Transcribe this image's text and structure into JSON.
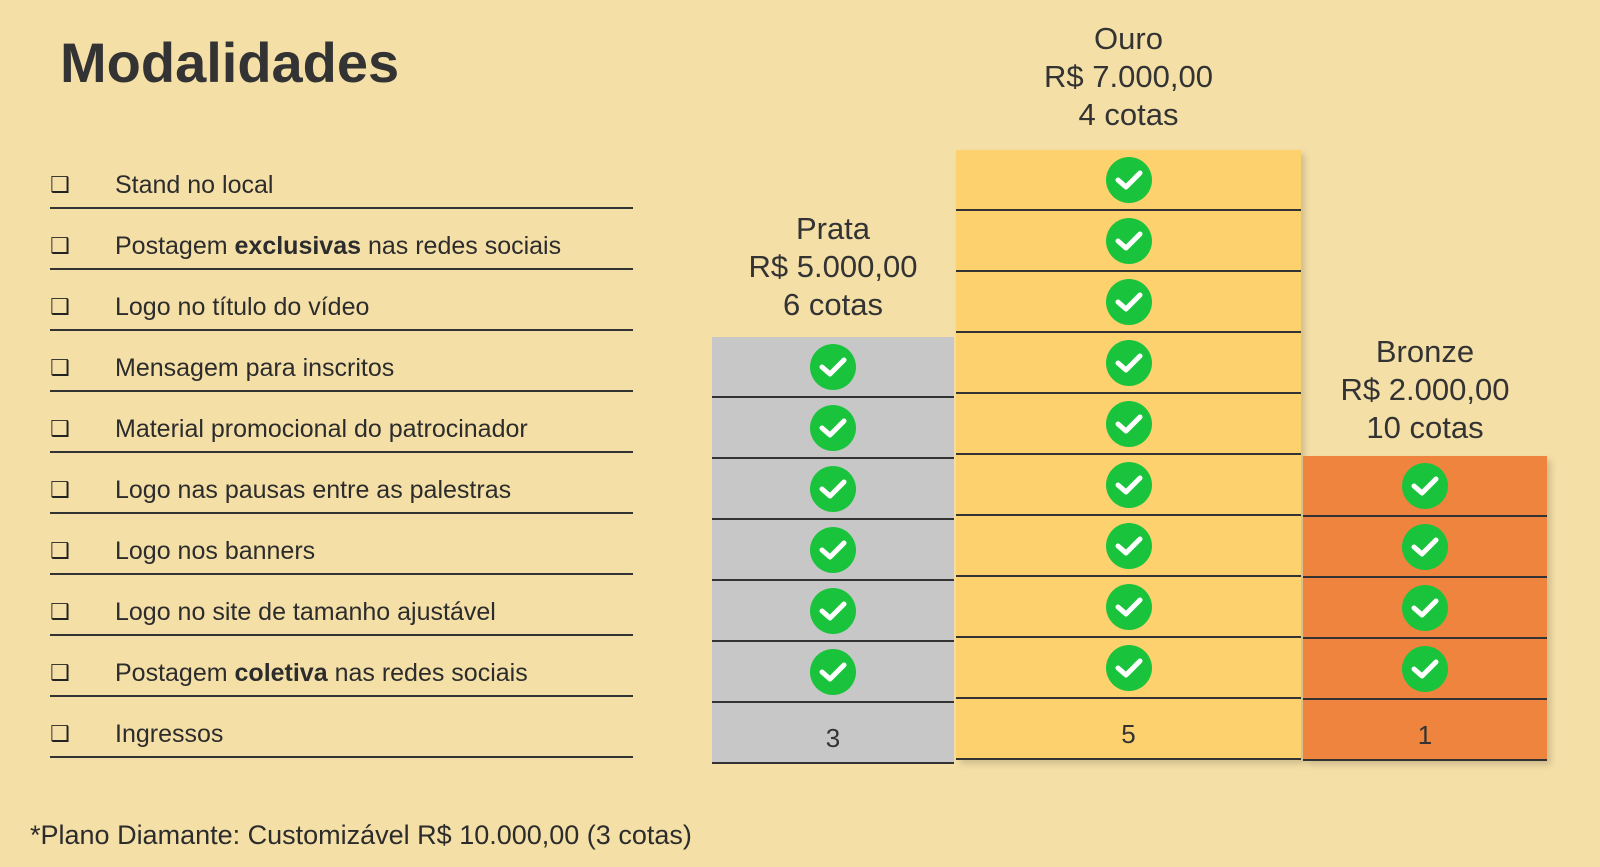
{
  "title": "Modalidades",
  "features": [
    {
      "pre": "Stand no local",
      "bold": "",
      "post": ""
    },
    {
      "pre": "Postagem ",
      "bold": "exclusivas",
      "post": " nas redes sociais"
    },
    {
      "pre": "Logo no título do vídeo",
      "bold": "",
      "post": ""
    },
    {
      "pre": "Mensagem para inscritos",
      "bold": "",
      "post": ""
    },
    {
      "pre": "Material promocional do patrocinador",
      "bold": "",
      "post": ""
    },
    {
      "pre": "Logo nas pausas entre as palestras",
      "bold": "",
      "post": ""
    },
    {
      "pre": "Logo nos banners",
      "bold": "",
      "post": ""
    },
    {
      "pre": "Logo no site de tamanho ajustável",
      "bold": "",
      "post": ""
    },
    {
      "pre": "Postagem ",
      "bold": "coletiva",
      "post": " nas redes sociais"
    },
    {
      "pre": "Ingressos",
      "bold": "",
      "post": ""
    }
  ],
  "bullet_glyph": "❑",
  "plans": {
    "prata": {
      "name": "Prata",
      "price": "R$ 5.000,00",
      "quota": "6 cotas",
      "tickets": "3",
      "color": "#c7c7c7"
    },
    "ouro": {
      "name": "Ouro",
      "price": "R$ 7.000,00",
      "quota": "4 cotas",
      "tickets": "5",
      "color": "#fed16f"
    },
    "bronze": {
      "name": "Bronze",
      "price": "R$ 2.000,00",
      "quota": "10 cotas",
      "tickets": "1",
      "color": "#ee843e"
    }
  },
  "check_icon": "check-circle-icon",
  "check_color": "#19c43c",
  "footnote": "*Plano Diamante: Customizável R$ 10.000,00 (3 cotas)"
}
